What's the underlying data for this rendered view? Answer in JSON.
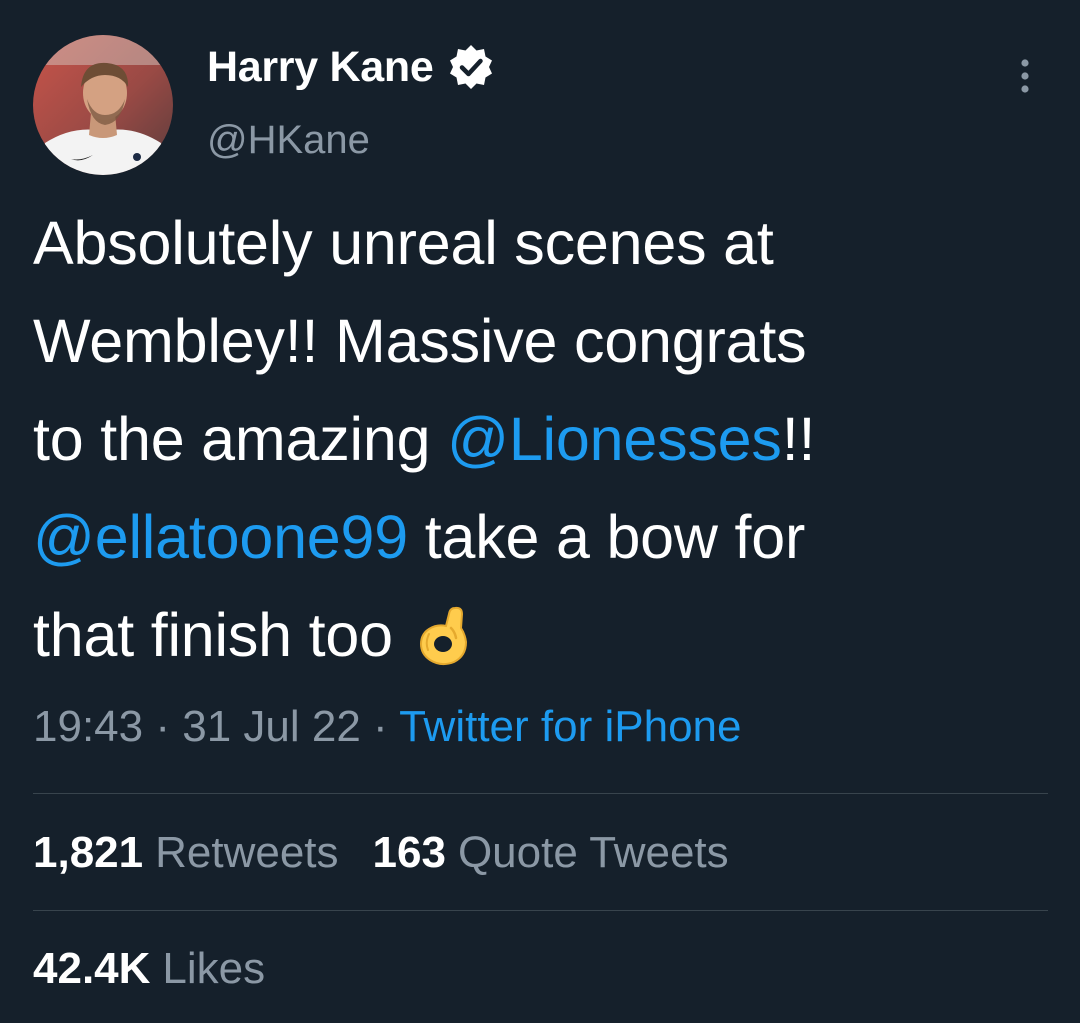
{
  "author": {
    "display_name": "Harry Kane",
    "handle": "@HKane",
    "verified_icon": "verified-badge-icon"
  },
  "tweet": {
    "line1": "Absolutely unreal scenes at",
    "line2": "Wembley!! Massive congrats",
    "line3_pre": "to the amazing ",
    "line3_mention": "@Lionesses",
    "line3_post": "!!",
    "line4_mention": "@ellatoone99",
    "line4_post": " take a bow for",
    "line5": "that finish too",
    "emoji": "ok-hand-emoji"
  },
  "meta": {
    "time": "19:43",
    "sep1": " · ",
    "date": "31 Jul 22",
    "sep2": " · ",
    "source": "Twitter for iPhone"
  },
  "stats": {
    "retweets_count": "1,821",
    "retweets_label": "Retweets",
    "quotes_count": "163",
    "quotes_label": "Quote Tweets",
    "likes_count": "42.4K",
    "likes_label": "Likes"
  },
  "colors": {
    "background": "#15202b",
    "text_primary": "#ffffff",
    "text_secondary": "#8b98a5",
    "accent": "#1d9bf0",
    "divider": "#38444d"
  }
}
